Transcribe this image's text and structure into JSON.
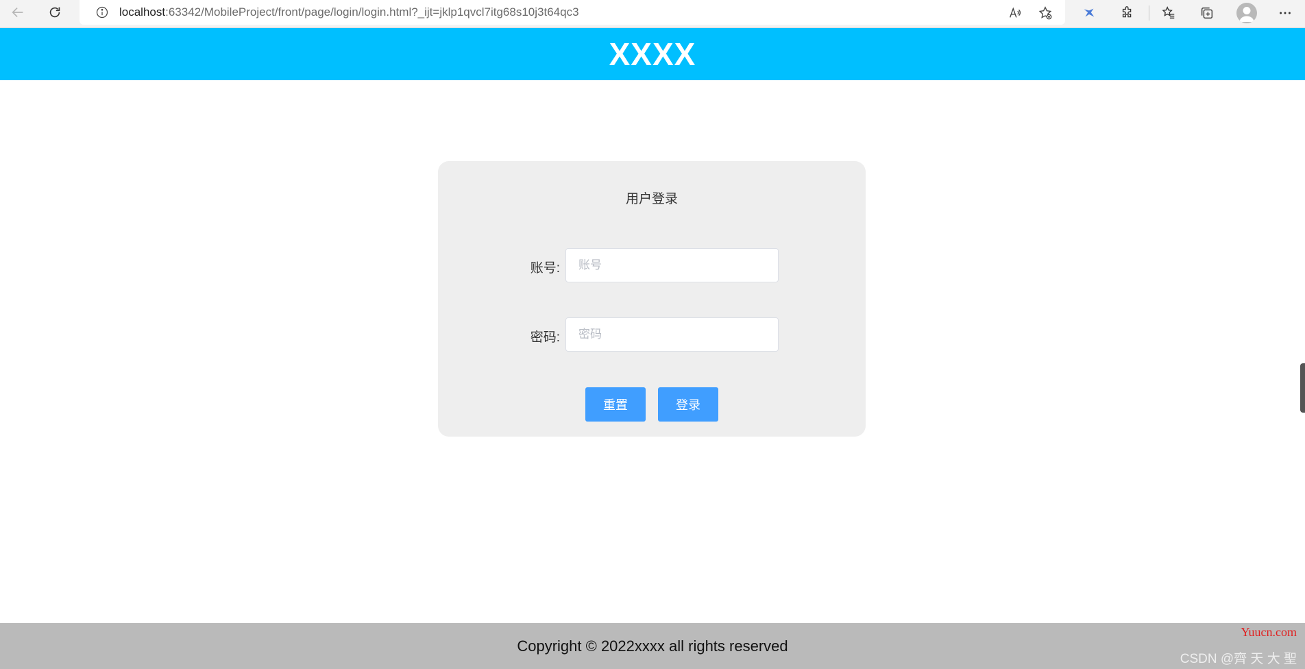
{
  "browser": {
    "url_host": "localhost",
    "url_rest": ":63342/MobileProject/front/page/login/login.html?_ijt=jklp1qvcl7itg68s10j3t64qc3"
  },
  "header": {
    "title": "XXXX",
    "bg_color": "#00bfff"
  },
  "login": {
    "title": "用户登录",
    "account_label": "账号:",
    "account_placeholder": "账号",
    "account_value": "",
    "password_label": "密码:",
    "password_placeholder": "密码",
    "password_value": "",
    "reset_label": "重置",
    "login_label": "登录",
    "button_color": "#409eff"
  },
  "footer": {
    "text": "Copyright © 2022xxxx all rights reserved"
  },
  "watermark": {
    "site": "Yuucn.com",
    "author": "CSDN @齊 天 大 聖"
  },
  "icons": {
    "back": "back-arrow-icon",
    "reload": "reload-icon",
    "info": "info-icon",
    "read_aloud": "read-aloud-icon",
    "add_favorite": "add-favorite-icon",
    "extension_bird": "bird-extension-icon",
    "extensions": "puzzle-icon",
    "favorites": "favorites-icon",
    "collections": "collections-icon",
    "profile": "avatar",
    "menu": "more-icon"
  }
}
